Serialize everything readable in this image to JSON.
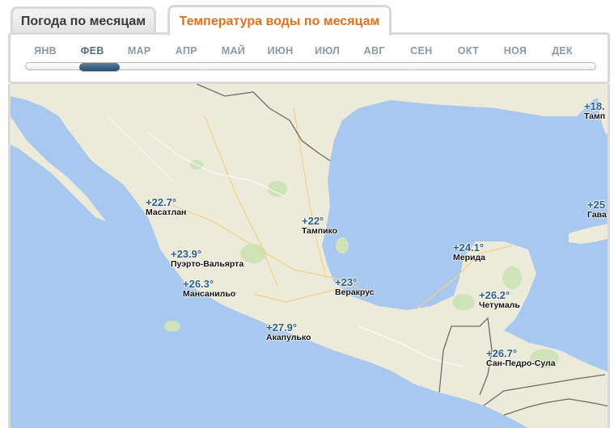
{
  "tabs": {
    "monthly_weather": "Погода по месяцам",
    "water_temp": "Температура воды по месяцам"
  },
  "months": [
    "ЯНВ",
    "ФЕВ",
    "МАР",
    "АПР",
    "МАЙ",
    "ИЮН",
    "ИЮЛ",
    "АВГ",
    "СЕН",
    "ОКТ",
    "НОЯ",
    "ДЕК"
  ],
  "selected_month": "ФЕВ",
  "markers": [
    {
      "temp": "+22.7°",
      "city": "Масатлан"
    },
    {
      "temp": "+22°",
      "city": "Тампико"
    },
    {
      "temp": "+23.9°",
      "city": "Пуэрто-Вальярта"
    },
    {
      "temp": "+26.3°",
      "city": "Мансанильо"
    },
    {
      "temp": "+23°",
      "city": "Веракрус"
    },
    {
      "temp": "+27.9°",
      "city": "Акапулько"
    },
    {
      "temp": "+24.1°",
      "city": "Мерида"
    },
    {
      "temp": "+26.2°",
      "city": "Четумаль"
    },
    {
      "temp": "+26.7°",
      "city": "Сан-Педро-Сула"
    },
    {
      "temp": "+18.",
      "city": "Тамп"
    },
    {
      "temp": "+25",
      "city": "Гава"
    }
  ],
  "colors": {
    "active_tab": "#e2711d",
    "temp": "#2f5f86",
    "water": "#a8c8f0",
    "land": "#ecead8"
  }
}
